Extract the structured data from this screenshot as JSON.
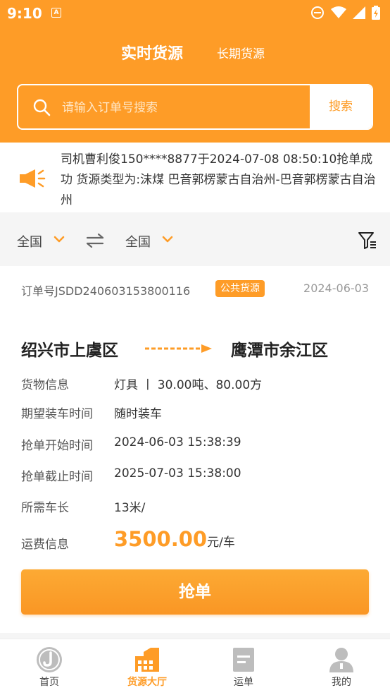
{
  "status_bar": {
    "time": "9:10",
    "notif_letter": "A"
  },
  "tabs": {
    "active": "实时货源",
    "other": "长期货源"
  },
  "search": {
    "placeholder": "请输入订单号搜索",
    "button": "搜索"
  },
  "notice": {
    "text": "司机曹利俊150****8877于2024-07-08 08:50:10抢单成功 货源类型为:沫煤 巴音郭楞蒙古自治州-巴音郭楞蒙古自治州"
  },
  "filter": {
    "from": "全国",
    "to": "全国"
  },
  "order": {
    "number": "订单号JSDD240603153800116",
    "badge": "公共货源",
    "date": "2024-06-03",
    "from": "绍兴市上虞区",
    "to": "鹰潭市余江区",
    "rows": [
      {
        "label": "货物信息",
        "value": "灯具 丨 30.00吨、80.00方"
      },
      {
        "label": "期望装车时间",
        "value": "随时装车"
      },
      {
        "label": "抢单开始时间",
        "value": "2024-06-03 15:38:39"
      },
      {
        "label": "抢单截止时间",
        "value": "2025-07-03 15:38:00"
      },
      {
        "label": "所需车长",
        "value": "13米/"
      }
    ],
    "price_label": "运费信息",
    "price": "3500.00",
    "price_unit": "元/车",
    "grab_button": "抢单"
  },
  "bottom_nav": [
    {
      "label": "首页",
      "icon": "home-logo-icon"
    },
    {
      "label": "货源大厅",
      "icon": "cargo-hall-icon"
    },
    {
      "label": "运单",
      "icon": "waybill-icon"
    },
    {
      "label": "我的",
      "icon": "person-icon"
    }
  ],
  "colors": {
    "accent": "#fe9c27",
    "text": "#333333",
    "muted": "#999999"
  }
}
